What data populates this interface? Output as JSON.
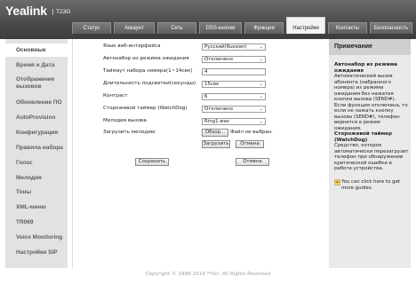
{
  "header": {
    "logo": "Yealink",
    "model": "T23G",
    "tabs": [
      {
        "label": "Статус"
      },
      {
        "label": "Аккаунт"
      },
      {
        "label": "Сеть"
      },
      {
        "label": "DSS-кнопки"
      },
      {
        "label": "Функции"
      },
      {
        "label": "Настройки",
        "active": true
      },
      {
        "label": "Контакты"
      },
      {
        "label": "Безопасность"
      }
    ]
  },
  "sidebar": {
    "items": [
      {
        "label": "Основные",
        "active": true
      },
      {
        "label": "Время и Дата"
      },
      {
        "label": "Отображение вызовов"
      },
      {
        "label": "Обновление ПО"
      },
      {
        "label": "AutoProvision"
      },
      {
        "label": "Конфигурация"
      },
      {
        "label": "Правила набора"
      },
      {
        "label": "Голос"
      },
      {
        "label": "Мелодия"
      },
      {
        "label": "Тоны"
      },
      {
        "label": "XML-меню"
      },
      {
        "label": "TR069"
      },
      {
        "label": "Voice Monitoring"
      },
      {
        "label": "Настройки SIP"
      }
    ]
  },
  "form": {
    "rows": [
      {
        "label": "Язык веб-интерфейса",
        "value": "Русский(Russian)",
        "type": "select"
      },
      {
        "label": "Автонабор из режима ожидания",
        "value": "Отключено",
        "type": "select"
      },
      {
        "label": "Таймаут набора номера(1~14сек)",
        "value": "4",
        "type": "input"
      },
      {
        "label": "Длительность подсветки(секунды)",
        "value": "15сек",
        "type": "select"
      },
      {
        "label": "Контраст",
        "value": "6",
        "type": "select"
      },
      {
        "label": "Сторожевой таймер (WatchDog)",
        "value": "Отключено",
        "type": "select"
      },
      {
        "label": "Мелодия вызова",
        "value": "Ring1.wav",
        "type": "select"
      }
    ],
    "upload": {
      "label": "Загрузить мелодию",
      "browse": "Обзор...",
      "file_status": "Файл не выбран.",
      "upload_btn": "Загрузить",
      "cancel_btn": "Отмена"
    },
    "save_btn": "Сохранить",
    "cancel_btn": "Отмена"
  },
  "help": {
    "title": "Примечание",
    "sections": [
      {
        "heading": "Автонабор из режима ожидания",
        "text": "Автоматический вызов абонента (набранного номера) из режима ожидания без нажатия кнопки вызова (SEND#). Если функция отключена, то если не нажать кнопку вызова (SEND#), телефон вернется в режим ожидания."
      },
      {
        "heading": "Сторожевой таймер (WatchDog)",
        "text": "Средство, которое автоматически перезагрузит телефон при обнаружении критической ошибки в работе устройства."
      }
    ],
    "more": "You can click here to get more guides."
  },
  "footer": {
    "copyright": "Copyright © 1998-2019 **Inc. All Rights Reserved"
  }
}
